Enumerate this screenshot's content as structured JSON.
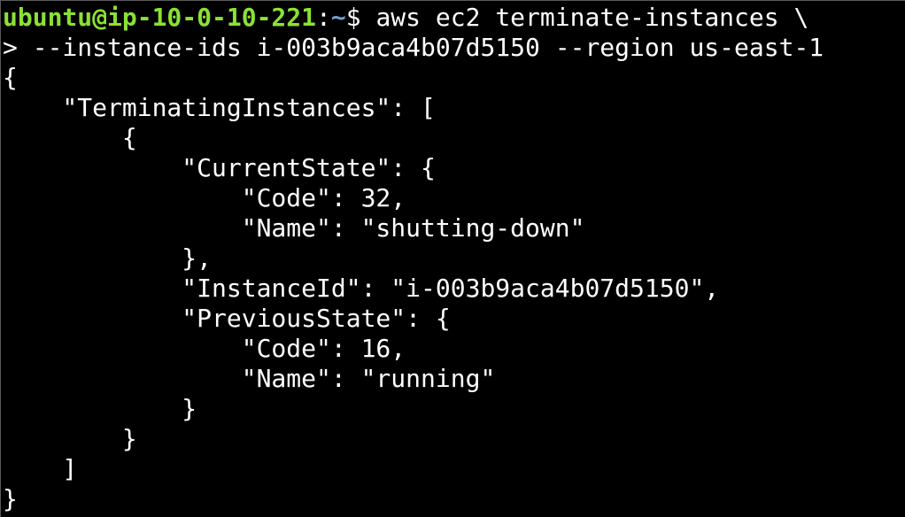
{
  "terminal": {
    "prompt": {
      "user_host": "ubuntu@ip-10-0-10-221",
      "separator": ":",
      "path": "~",
      "symbol": "$ "
    },
    "command": "aws ec2 terminate-instances \\",
    "lines": [
      "> --instance-ids i-003b9aca4b07d5150 --region us-east-1",
      "{",
      "    \"TerminatingInstances\": [",
      "        {",
      "            \"CurrentState\": {",
      "                \"Code\": 32,",
      "                \"Name\": \"shutting-down\"",
      "            },",
      "            \"InstanceId\": \"i-003b9aca4b07d5150\",",
      "            \"PreviousState\": {",
      "                \"Code\": 16,",
      "                \"Name\": \"running\"",
      "            }",
      "        }",
      "    ]",
      "}"
    ],
    "colors": {
      "background": "#000000",
      "text": "#ffffff",
      "user_host": "#8ae234",
      "path": "#729fcf"
    }
  }
}
